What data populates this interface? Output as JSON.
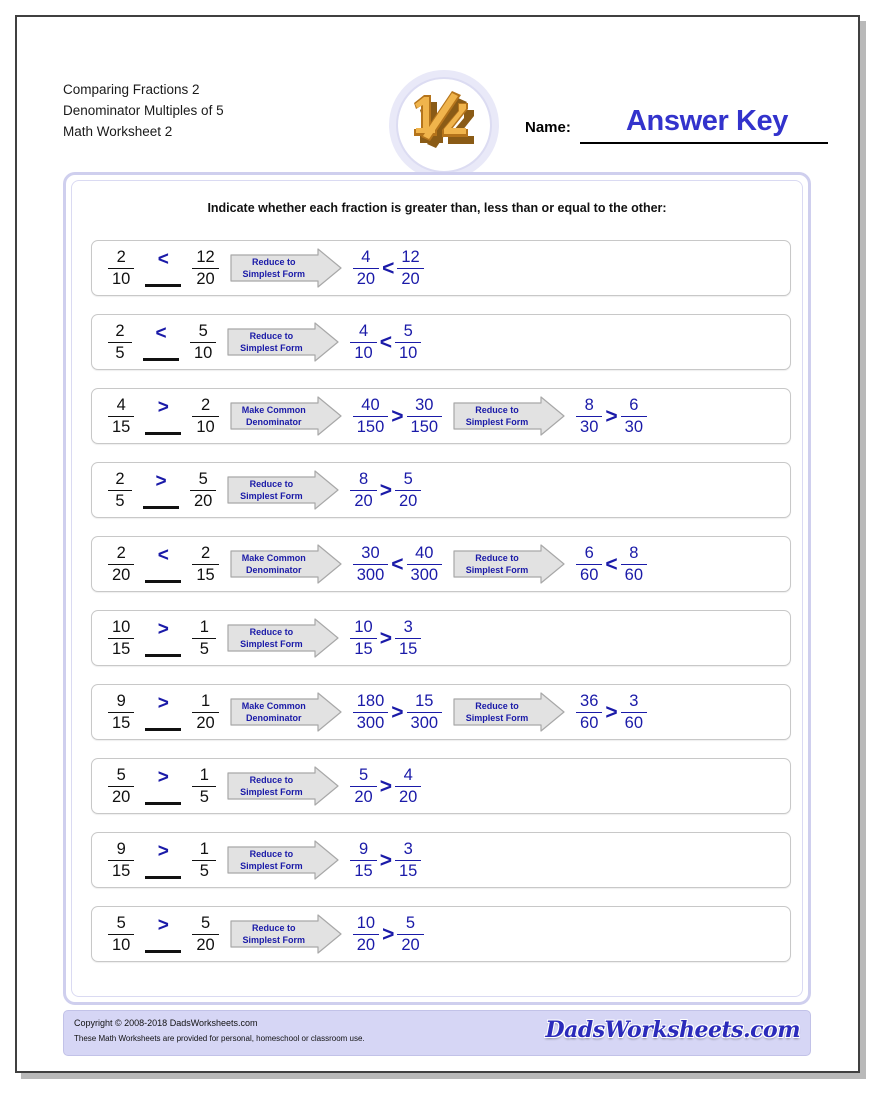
{
  "header": {
    "title_lines": [
      "Comparing Fractions 2",
      "Denominator Multiples of 5",
      "Math Worksheet 2"
    ],
    "logo_alt": "one-half-logo",
    "name_label": "Name:",
    "name_value": "Answer Key"
  },
  "instructions": "Indicate whether each fraction is greater than, less than or equal to the other:",
  "ops": {
    "reduce": [
      "Reduce to",
      "Simplest Form"
    ],
    "common": [
      "Make Common",
      "Denominator"
    ]
  },
  "problems": [
    {
      "left": {
        "num": "2",
        "den": "10"
      },
      "symbol": "<",
      "right": {
        "num": "12",
        "den": "20"
      },
      "steps": [
        {
          "op": [
            "Reduce to",
            "Simplest Form"
          ],
          "left": {
            "num": "4",
            "den": "20"
          },
          "symbol": "<",
          "right": {
            "num": "12",
            "den": "20"
          }
        }
      ]
    },
    {
      "left": {
        "num": "2",
        "den": "5"
      },
      "symbol": "<",
      "right": {
        "num": "5",
        "den": "10"
      },
      "steps": [
        {
          "op": [
            "Reduce to",
            "Simplest Form"
          ],
          "left": {
            "num": "4",
            "den": "10"
          },
          "symbol": "<",
          "right": {
            "num": "5",
            "den": "10"
          }
        }
      ]
    },
    {
      "left": {
        "num": "4",
        "den": "15"
      },
      "symbol": ">",
      "right": {
        "num": "2",
        "den": "10"
      },
      "steps": [
        {
          "op": [
            "Make Common",
            "Denominator"
          ],
          "left": {
            "num": "40",
            "den": "150"
          },
          "symbol": ">",
          "right": {
            "num": "30",
            "den": "150"
          }
        },
        {
          "op": [
            "Reduce to",
            "Simplest Form"
          ],
          "left": {
            "num": "8",
            "den": "30"
          },
          "symbol": ">",
          "right": {
            "num": "6",
            "den": "30"
          }
        }
      ]
    },
    {
      "left": {
        "num": "2",
        "den": "5"
      },
      "symbol": ">",
      "right": {
        "num": "5",
        "den": "20"
      },
      "steps": [
        {
          "op": [
            "Reduce to",
            "Simplest Form"
          ],
          "left": {
            "num": "8",
            "den": "20"
          },
          "symbol": ">",
          "right": {
            "num": "5",
            "den": "20"
          }
        }
      ]
    },
    {
      "left": {
        "num": "2",
        "den": "20"
      },
      "symbol": "<",
      "right": {
        "num": "2",
        "den": "15"
      },
      "steps": [
        {
          "op": [
            "Make Common",
            "Denominator"
          ],
          "left": {
            "num": "30",
            "den": "300"
          },
          "symbol": "<",
          "right": {
            "num": "40",
            "den": "300"
          }
        },
        {
          "op": [
            "Reduce to",
            "Simplest Form"
          ],
          "left": {
            "num": "6",
            "den": "60"
          },
          "symbol": "<",
          "right": {
            "num": "8",
            "den": "60"
          }
        }
      ]
    },
    {
      "left": {
        "num": "10",
        "den": "15"
      },
      "symbol": ">",
      "right": {
        "num": "1",
        "den": "5"
      },
      "steps": [
        {
          "op": [
            "Reduce to",
            "Simplest Form"
          ],
          "left": {
            "num": "10",
            "den": "15"
          },
          "symbol": ">",
          "right": {
            "num": "3",
            "den": "15"
          }
        }
      ]
    },
    {
      "left": {
        "num": "9",
        "den": "15"
      },
      "symbol": ">",
      "right": {
        "num": "1",
        "den": "20"
      },
      "steps": [
        {
          "op": [
            "Make Common",
            "Denominator"
          ],
          "left": {
            "num": "180",
            "den": "300"
          },
          "symbol": ">",
          "right": {
            "num": "15",
            "den": "300"
          }
        },
        {
          "op": [
            "Reduce to",
            "Simplest Form"
          ],
          "left": {
            "num": "36",
            "den": "60"
          },
          "symbol": ">",
          "right": {
            "num": "3",
            "den": "60"
          }
        }
      ]
    },
    {
      "left": {
        "num": "5",
        "den": "20"
      },
      "symbol": ">",
      "right": {
        "num": "1",
        "den": "5"
      },
      "steps": [
        {
          "op": [
            "Reduce to",
            "Simplest Form"
          ],
          "left": {
            "num": "5",
            "den": "20"
          },
          "symbol": ">",
          "right": {
            "num": "4",
            "den": "20"
          }
        }
      ]
    },
    {
      "left": {
        "num": "9",
        "den": "15"
      },
      "symbol": ">",
      "right": {
        "num": "1",
        "den": "5"
      },
      "steps": [
        {
          "op": [
            "Reduce to",
            "Simplest Form"
          ],
          "left": {
            "num": "9",
            "den": "15"
          },
          "symbol": ">",
          "right": {
            "num": "3",
            "den": "15"
          }
        }
      ]
    },
    {
      "left": {
        "num": "5",
        "den": "10"
      },
      "symbol": ">",
      "right": {
        "num": "5",
        "den": "20"
      },
      "steps": [
        {
          "op": [
            "Reduce to",
            "Simplest Form"
          ],
          "left": {
            "num": "10",
            "den": "20"
          },
          "symbol": ">",
          "right": {
            "num": "5",
            "den": "20"
          }
        }
      ]
    }
  ],
  "footer": {
    "copyright": "Copyright © 2008-2018 DadsWorksheets.com",
    "usage": "These Math Worksheets are provided for personal, homeschool or classroom use.",
    "brand": "DadsWorksheets.com"
  },
  "colors": {
    "answer_blue": "#1a1aa8",
    "name_blue": "#3333cc",
    "panel_border": "#cfcfee",
    "footer_bg": "#d6d6f5",
    "logo_gold": "#e8a33d"
  }
}
